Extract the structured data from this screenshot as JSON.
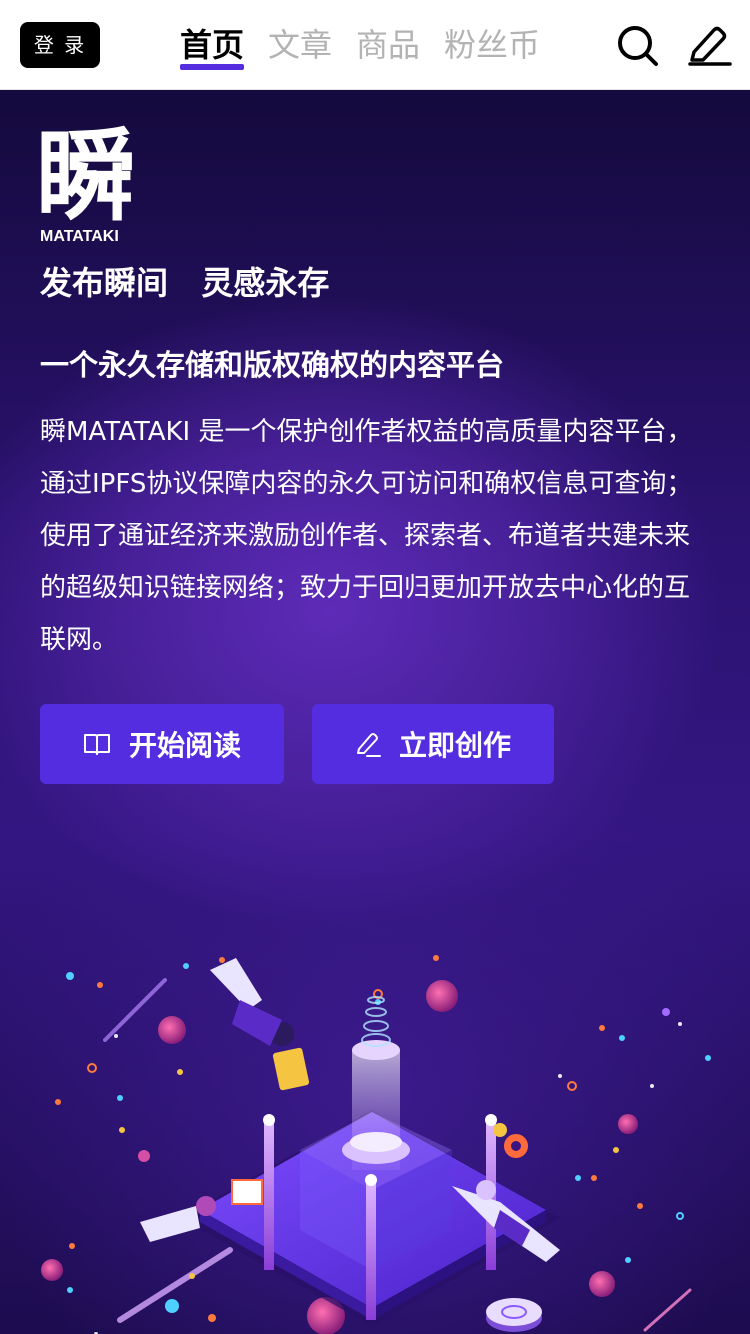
{
  "header": {
    "login_label": "登 录",
    "tabs": [
      {
        "label": "首页",
        "active": true
      },
      {
        "label": "文章",
        "active": false
      },
      {
        "label": "商品",
        "active": false
      },
      {
        "label": "粉丝币",
        "active": false
      }
    ],
    "icons": [
      "search-icon",
      "edit-icon"
    ]
  },
  "hero": {
    "logo_char": "瞬",
    "logo_word": "MATATAKI",
    "slogan": "发布瞬间   灵感永存",
    "subtitle": "一个永久存储和版权确权的内容平台",
    "description": "瞬MATATAKI 是一个保护创作者权益的高质量内容平台，通过IPFS协议保障内容的永久可访问和确权信息可查询；使用了通证经济来激励创作者、探索者、布道者共建未来的超级知识链接网络；致力于回归更加开放去中心化的互联网。",
    "buttons": {
      "read": {
        "label": "开始阅读",
        "icon": "book-icon"
      },
      "write": {
        "label": "立即创作",
        "icon": "pen-icon"
      }
    }
  },
  "colors": {
    "accent": "#542de0",
    "header_bg": "#ffffff",
    "hero_bg": "#2b1270",
    "tab_inactive": "#b3b3b3"
  }
}
